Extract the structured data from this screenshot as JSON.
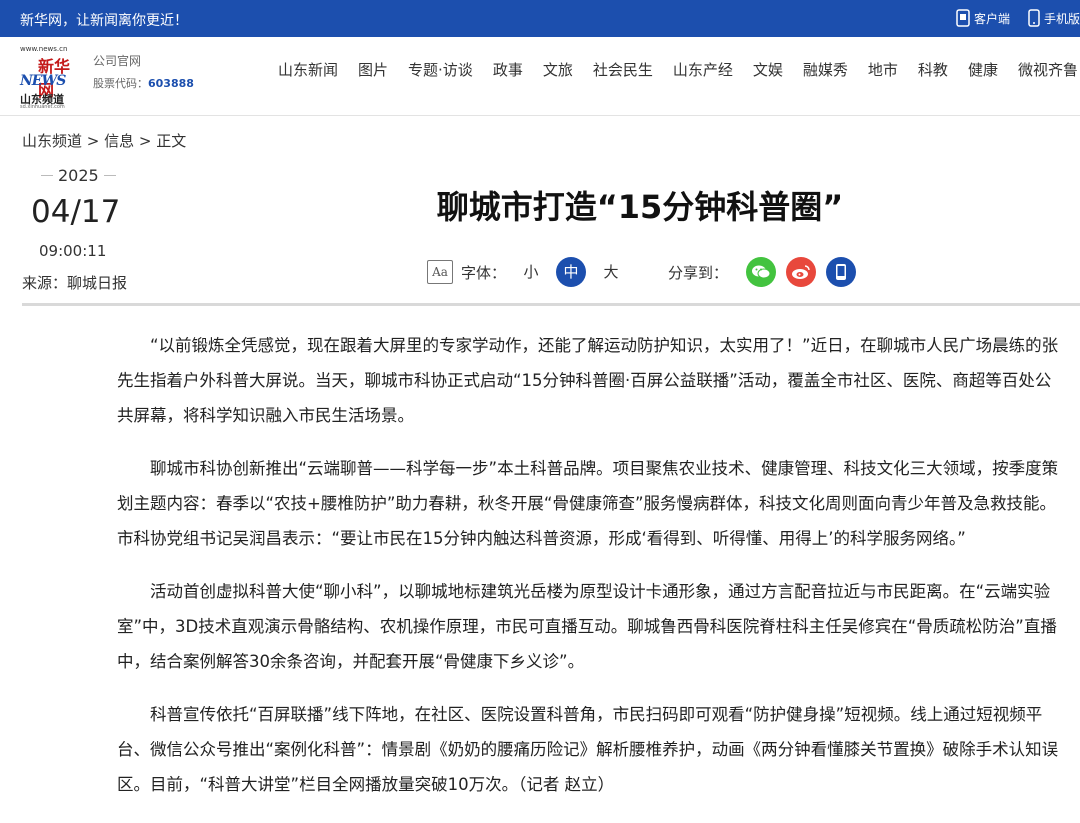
{
  "topbar": {
    "slogan": "新华网，让新闻离你更近！",
    "client_label": "客户端",
    "mobile_label": "手机版"
  },
  "header": {
    "logo_url": "www.news.cn",
    "logo_name": "新华网",
    "logo_news": "NEWS",
    "logo_channel": "山东频道",
    "logo_small": "sd.xinhuanet.com",
    "official_label": "公司官网",
    "stock_label": "股票代码：",
    "stock_code": "603888"
  },
  "nav": [
    "山东新闻",
    "图片",
    "专题·访谈",
    "政事",
    "文旅",
    "社会民生",
    "山东产经",
    "文娱",
    "融媒秀",
    "地市",
    "科教",
    "健康",
    "微视齐鲁"
  ],
  "breadcrumb": {
    "home": "山东频道",
    "sep1": " > ",
    "section": "信息",
    "sep2": " > ",
    "current": "正文"
  },
  "meta": {
    "year": "2025",
    "month_day": "04/17",
    "time": "09:00:11",
    "source": "来源：聊城日报"
  },
  "title": "聊城市打造“15分钟科普圈”",
  "tools": {
    "font_label": "字体：",
    "font_icon": "Aa",
    "small": "小",
    "medium": "中",
    "large": "大",
    "share_label": "分享到："
  },
  "article": [
    "“以前锻炼全凭感觉，现在跟着大屏里的专家学动作，还能了解运动防护知识，太实用了！”近日，在聊城市人民广场晨练的张先生指着户外科普大屏说。当天，聊城市科协正式启动“15分钟科普圈·百屏公益联播”活动，覆盖全市社区、医院、商超等百处公共屏幕，将科学知识融入市民生活场景。",
    "聊城市科协创新推出“云端聊普——科学每一步”本土科普品牌。项目聚焦农业技术、健康管理、科技文化三大领域，按季度策划主题内容：春季以“农技+腰椎防护”助力春耕，秋冬开展“骨健康筛查”服务慢病群体，科技文化周则面向青少年普及急救技能。市科协党组书记吴润昌表示：“要让市民在15分钟内触达科普资源，形成‘看得到、听得懂、用得上’的科学服务网络。”",
    "活动首创虚拟科普大使“聊小科”，以聊城地标建筑光岳楼为原型设计卡通形象，通过方言配音拉近与市民距离。在“云端实验室”中，3D技术直观演示骨骼结构、农机操作原理，市民可直播互动。聊城鲁西骨科医院脊柱科主任吴修宾在“骨质疏松防治”直播中，结合案例解答30余条咨询，并配套开展“骨健康下乡义诊”。",
    "科普宣传依托“百屏联播”线下阵地，在社区、医院设置科普角，市民扫码即可观看“防护健身操”短视频。线上通过短视频平台、微信公众号推出“案例化科普”：情景剧《奶奶的腰痛历险记》解析腰椎养护，动画《两分钟看懂膝关节置换》破除手术认知误区。目前，“科普大讲堂”栏目全网播放量突破10万次。（记者 赵立）"
  ]
}
